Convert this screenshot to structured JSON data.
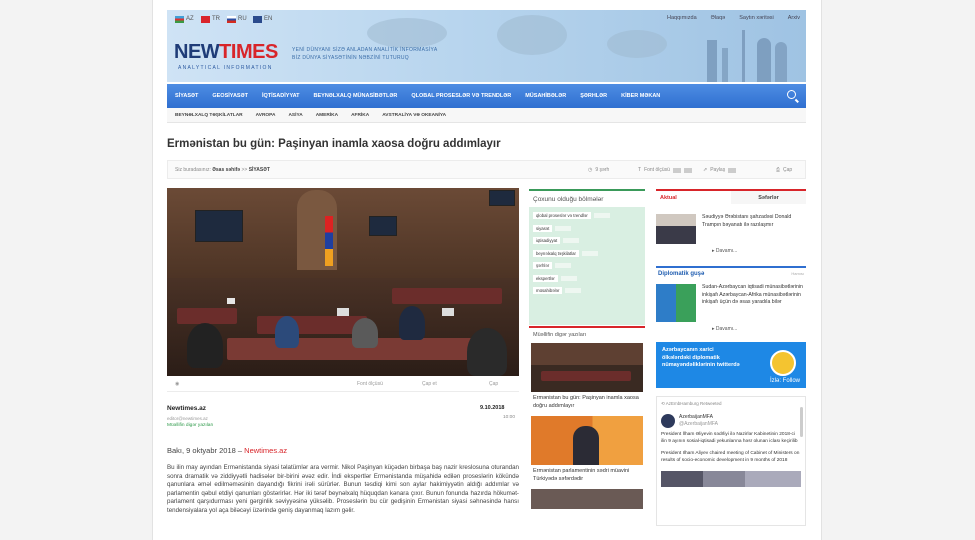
{
  "header": {
    "languages": [
      {
        "code": "AZ",
        "cls": "f-az"
      },
      {
        "code": "TR",
        "cls": "f-tr"
      },
      {
        "code": "RU",
        "cls": "f-ru"
      },
      {
        "code": "EN",
        "cls": "f-en"
      }
    ],
    "top_links": [
      "Haqqımızda",
      "Əlaqə",
      "Saytın xəritəsi",
      "Arxiv"
    ],
    "logo_new": "NEW",
    "logo_times": "TIMES",
    "logo_sub": "ANALYTICAL INFORMATION",
    "slogan_1": "YENİ DÜNYANI SİZƏ ANLADAN ANALİTİK İNFORMASİYA",
    "slogan_2": "BİZ DÜNYA SİYASƏTİNİN NƏBZİNİ TUTURUQ"
  },
  "nav": {
    "items": [
      "SİYASƏT",
      "GEOSİYASƏT",
      "İQTİSADİYYAT",
      "BEYNƏLXALQ MÜNASİBƏTLƏR",
      "QLOBAL PROSESLƏR VƏ TRENDLƏR",
      "MÜSAHİBƏLƏR",
      "ŞƏRHLƏR",
      "KİBER MƏKAN"
    ],
    "search_icon": "search-icon"
  },
  "subnav": {
    "items": [
      "BEYNƏLXALQ TƏŞKİLATLAR",
      "AVROPA",
      "ASİYA",
      "AMERİKA",
      "AFRİKA",
      "AVSTRALİYA VƏ OKEANİYA"
    ]
  },
  "article": {
    "title": "Ermənistan bu gün: Paşinyan inamla xaosa doğru addımlayır",
    "crumbs_prefix": "Siz buradasınız:",
    "crumbs_home": "Əsas səhifə",
    "crumbs_section": "SİYASƏT",
    "views": "9 şərh",
    "font_label": "Font ölçüsü",
    "print_label": "Çap",
    "print_label2": "Çap et",
    "share_label": "Paylaş",
    "author": "Newtimes.az",
    "author_email": "editor@newtimes.az",
    "author_link": "Müəllifin digər yazıları",
    "date": "9.10.2018",
    "time": "10:00",
    "dateline_prefix": "Bakı, 9 oktyabr 2018 –",
    "dateline_source": "Newtimes.az",
    "body": "Bu ilin may ayından Ermənistanda siyasi təlatümlər ara vermir. Nikol Paşinyan küçədən birbaşa baş nazir kreslosuna oturandan sonra dramatik və ziddiyyətli hadisələr bir-birini əvəz edir. İndi ekspertlər Ermənistanda müşahidə edilən proseslərin kökündə qanunlara əməl edilməməsinin dayandığı fikrini irəli sürürlər. Bunun təsdiqi kimi son aylar hakimiyyətin aldığı addımlar və parlamentin qəbul etdiyi qanunları göstərirlər. Hər iki tərəf beynəlxalq hüquqdan kənara çıxır. Bunun fonunda hazırda hökumət-parlament qarşıdurması yeni gərginlik səviyyəsinə yüksəlib. Proseslərin bu cür gedişinin Ermənistan siyasi səhnəsində hansı tendensiyalara yol aça biləcəyi üzərində geniş dayanmaq lazım gəlir."
  },
  "sidebar_mid": {
    "cats_title": "Çoxunu olduğu bölmələr",
    "cats": [
      "qlobal proseslər və trendlər",
      "siyasət",
      "iqtisadiyyat",
      "beynəlxalq təşkilatlar",
      "şərhlər",
      "ekspertlər",
      "müsahibələr"
    ],
    "other_title": "Müəllifin digər yazıları",
    "other_items": [
      "Ermənistan bu gün: Paşinyan inamla xaosa doğru addımlayır",
      "Ermənistan parlamentinin sədri müavini Türkiyədə səfərdədir"
    ]
  },
  "sidebar_right": {
    "tab_active": "Aktual",
    "tab_other": "Səfərlər",
    "news": [
      "Səudiyyə Ərəbistanı şahzadəsi Donald Trampın bəyanatı ilə razılaşmır",
      "Sudan-Azərbaycan iqtisadi münasibətlərinin inkişafı Azərbaycan-Afrika münasibətlərinin inkişafı üçün də əsas yaradıla bilər"
    ],
    "more": "Davamı...",
    "dg_title": "Diplomatik guşə",
    "dg_all": "Hamısı",
    "twitter_line1": "Azərbaycanın xarici",
    "twitter_line2": "ölkələrdəki diplomatik",
    "twitter_line3": "nümayəndəliklərinin twitterdə",
    "twitter_follow": "İzlə: Follow",
    "feed_header": "AzEmbHamburg Retweeted",
    "feed_account": "AzerbaijanMFA",
    "feed_handle": "@AzerbaijanMFA",
    "feed_tweet1": "President İlham Əliyevin sədrliyi ilə Nazirlər Kabinetinin 2018-ci ilin 9 ayının sosial-iqtisadi yekunlarına həsr olunan iclası keçirilib",
    "feed_tweet2": "President Ilham Aliyev chaired meeting of Cabinet of Ministers on results of socio-economic development in 9 months of 2018"
  }
}
